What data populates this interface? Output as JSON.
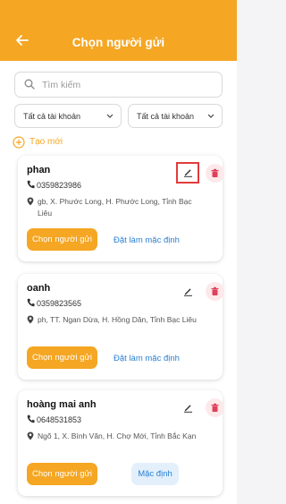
{
  "header": {
    "title": "Chọn người gửi"
  },
  "search": {
    "placeholder": "Tìm kiếm"
  },
  "filters": [
    {
      "value": "Tất cả tài khoản"
    },
    {
      "value": "Tất cả tài khoản"
    }
  ],
  "create_label": "Tạo mới",
  "senders": [
    {
      "name": "phan",
      "phone": "0359823986",
      "address": "gb, X. Phước Long, H. Phước Long, Tỉnh Bạc Liêu",
      "select_label": "Chọn người gửi",
      "default_label": "Đặt làm mặc định"
    },
    {
      "name": "oanh",
      "phone": "0359823565",
      "address": "ph, TT. Ngan Dừa, H. Hồng Dân, Tỉnh Bạc Liêu",
      "select_label": "Chọn người gửi",
      "default_label": "Đặt làm mặc định"
    },
    {
      "name": "hoàng mai anh",
      "phone": "0648531853",
      "address": "Ngõ 1, X. Bình Văn, H. Chợ Mới, Tỉnh Bắc Kạn",
      "select_label": "Chọn người gửi",
      "default_label": "Mặc định"
    }
  ],
  "colors": {
    "accent": "#f5a623",
    "link": "#2b7fd1",
    "delete_bg": "#fde8ea",
    "delete_icon": "#e0405a",
    "highlight": "#e23b3b"
  },
  "icons": [
    "back-arrow-icon",
    "search-icon",
    "chevron-down-icon",
    "plus-circle-icon",
    "phone-icon",
    "location-pin-icon",
    "pencil-icon",
    "trash-icon"
  ]
}
